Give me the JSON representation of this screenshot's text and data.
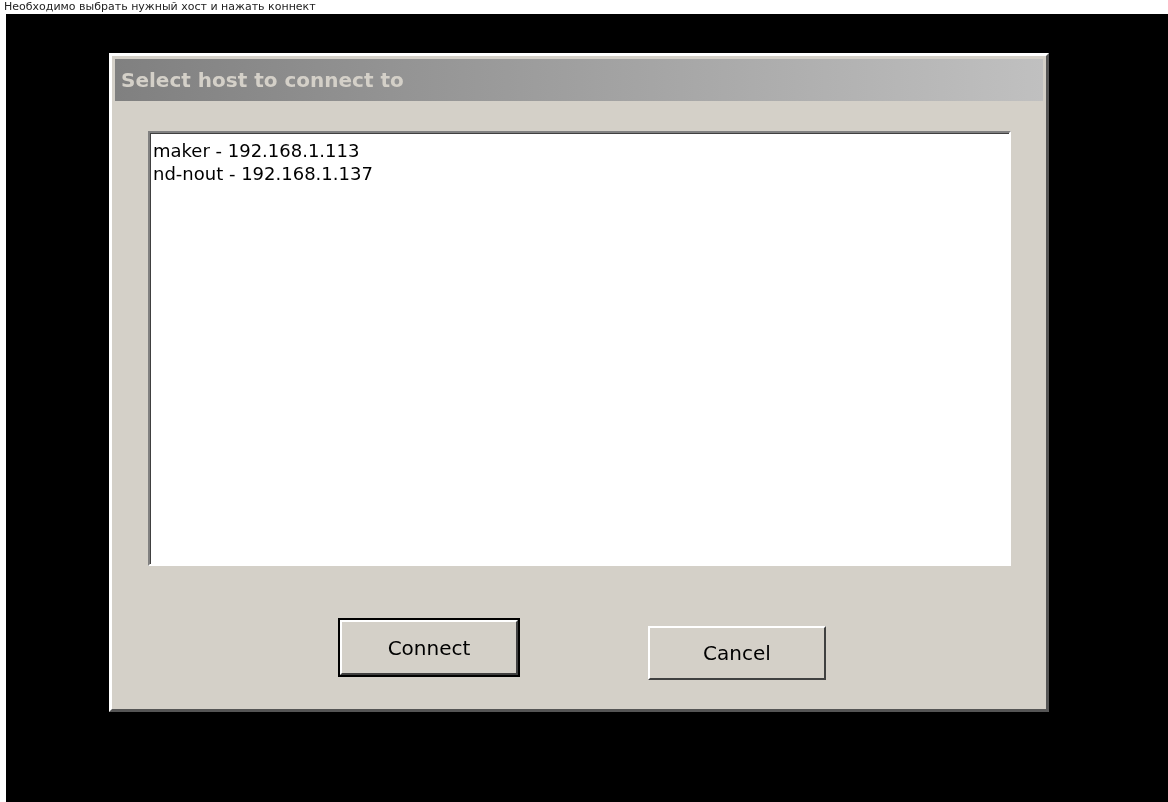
{
  "caption": "Необходимо выбрать нужный хост и нажать коннект",
  "window": {
    "title": "Select host to connect to"
  },
  "hosts": [
    {
      "label": "maker - 192.168.1.113"
    },
    {
      "label": "nd-nout - 192.168.1.137"
    }
  ],
  "buttons": [
    {
      "label": "Connect",
      "default": true
    },
    {
      "label": "Cancel",
      "default": false
    }
  ]
}
